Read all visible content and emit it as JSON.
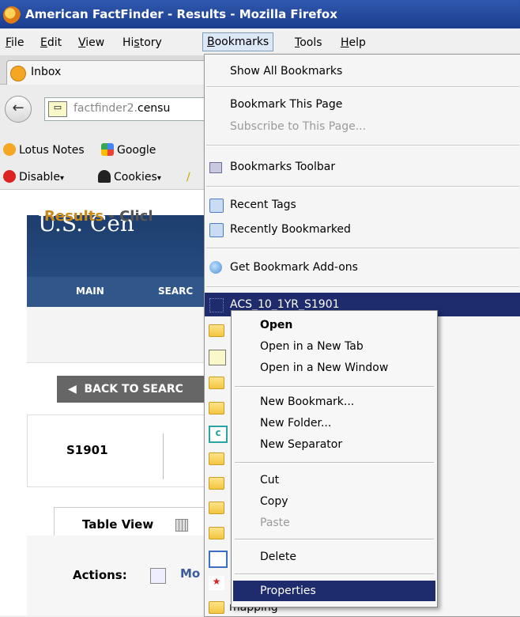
{
  "window": {
    "title": "American FactFinder - Results - Mozilla Firefox"
  },
  "menubar": {
    "items": [
      "File",
      "Edit",
      "View",
      "History",
      "Bookmarks",
      "Tools",
      "Help"
    ]
  },
  "tabs": [
    {
      "label": "Inbox"
    }
  ],
  "nav": {
    "url_prefix": "factfinder2.",
    "url_domain": "censu"
  },
  "bookmarks_toolbar": {
    "items": [
      "Lotus Notes",
      "Google",
      "Disable",
      "Cookies"
    ]
  },
  "page": {
    "header_title": "U.S. Cen",
    "nav_items": [
      "MAIN",
      "SEARC"
    ],
    "results_title": "Results",
    "results_suffix": " - Clicl",
    "back_button": "BACK TO SEARC",
    "table_id": "S1901",
    "tab_label": "Table View",
    "actions_label": "Actions:",
    "actions_more": "Mo"
  },
  "bookmarks_menu": {
    "items": [
      {
        "label": "Show All Bookmarks"
      },
      {
        "label": "Bookmark This Page"
      },
      {
        "label": "Subscribe to This Page...",
        "disabled": true
      },
      {
        "label": "Bookmarks Toolbar"
      },
      {
        "label": "Recent Tags"
      },
      {
        "label": "Recently Bookmarked"
      },
      {
        "label": "Get Bookmark Add-ons"
      },
      {
        "label": "ACS_10_1YR_S1901",
        "highlighted": true
      }
    ]
  },
  "context_menu": {
    "items": [
      {
        "label": "Open",
        "bold": true
      },
      {
        "label": "Open in a New Tab"
      },
      {
        "label": "Open in a New Window"
      },
      {
        "label": "New Bookmark..."
      },
      {
        "label": "New Folder..."
      },
      {
        "label": "New Separator"
      },
      {
        "label": "Cut"
      },
      {
        "label": "Copy"
      },
      {
        "label": "Paste",
        "disabled": true
      },
      {
        "label": "Delete"
      },
      {
        "label": "Properties",
        "highlighted": true
      }
    ]
  },
  "partial_text": {
    "right_e": "e",
    "mapping": "mapping"
  },
  "colors": {
    "highlight": "#1e2b6c",
    "titlebar": "#2f58ad",
    "results_orange": "#c88a1a"
  }
}
